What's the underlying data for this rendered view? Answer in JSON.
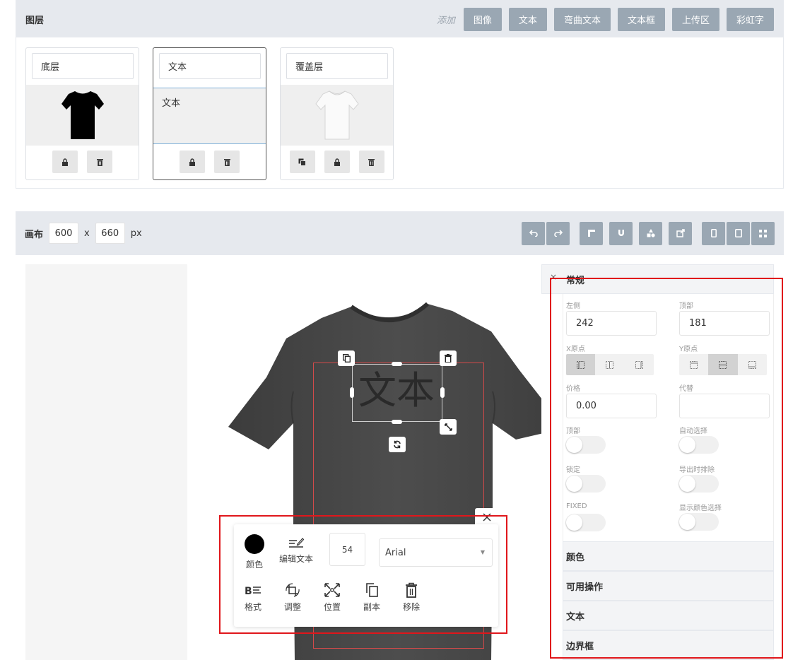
{
  "layers": {
    "title": "图层",
    "add_label": "添加",
    "add_buttons": [
      "图像",
      "文本",
      "弯曲文本",
      "文本框",
      "上传区",
      "彩虹字"
    ],
    "cards": [
      {
        "name": "底层",
        "thumb": "black-tshirt"
      },
      {
        "name": "文本",
        "thumb": "text",
        "preview_text": "文本",
        "active": true
      },
      {
        "name": "覆盖层",
        "thumb": "white-tshirt"
      }
    ]
  },
  "canvas": {
    "label": "画布",
    "width": "600",
    "x": "x",
    "height": "660",
    "unit": "px"
  },
  "stage": {
    "object_text": "文本",
    "shirt_color": "#4a4a4a"
  },
  "editor": {
    "color_label": "颜色",
    "edit_text_label": "编辑文本",
    "font_size": "54",
    "font_family": "Arial",
    "format_label": "格式",
    "adjust_label": "调整",
    "position_label": "位置",
    "copy_label": "副本",
    "remove_label": "移除",
    "color_value": "#000000"
  },
  "props": {
    "x_mark": "×",
    "general_title": "常规",
    "left_label": "左侧",
    "left_value": "242",
    "top_label": "顶部",
    "top_value": "181",
    "origin_x_label": "X原点",
    "origin_y_label": "Y原点",
    "price_label": "价格",
    "price_value": "0.00",
    "replace_label": "代替",
    "replace_value": "",
    "top_toggle_label": "顶部",
    "auto_select_label": "自动选择",
    "lock_label": "锁定",
    "export_exclude_label": "导出时排除",
    "fixed_label": "FIXED",
    "show_color_select_label": "显示颜色选择",
    "sections": [
      "颜色",
      "可用操作",
      "文本",
      "边界框"
    ]
  },
  "colors": {
    "accent_gray": "#9aa7b3",
    "highlight_red": "#e0161b"
  }
}
